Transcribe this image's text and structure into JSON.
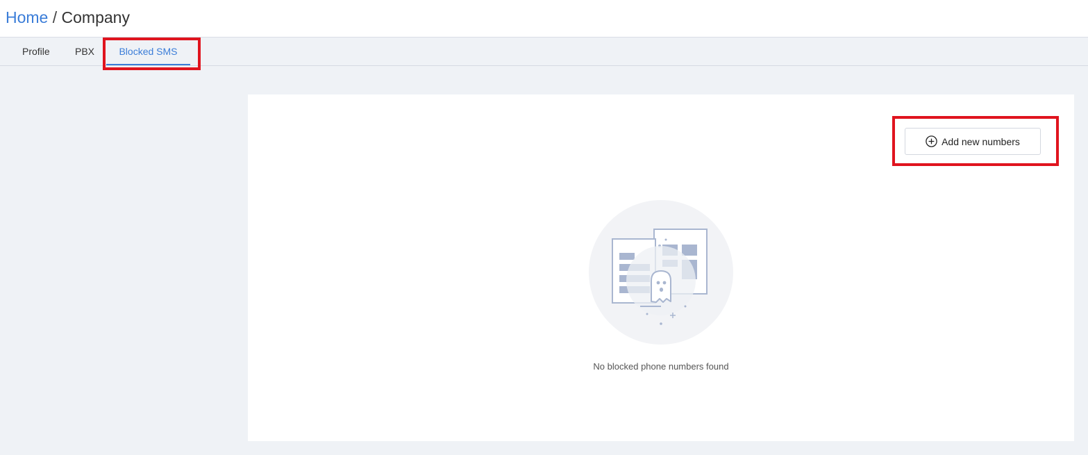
{
  "breadcrumb": {
    "home": "Home",
    "separator": "/",
    "current": "Company"
  },
  "tabs": [
    {
      "label": "Profile",
      "active": false
    },
    {
      "label": "PBX",
      "active": false
    },
    {
      "label": "Blocked SMS",
      "active": true
    }
  ],
  "toolbar": {
    "add_button_label": "Add new numbers",
    "add_button_icon": "plus-circle-icon"
  },
  "empty_state": {
    "illustration": "empty-documents-ghost-illustration",
    "message": "No blocked phone numbers found"
  },
  "colors": {
    "accent": "#3b7dd8",
    "highlight": "#e0141e",
    "background": "#eff2f6"
  }
}
